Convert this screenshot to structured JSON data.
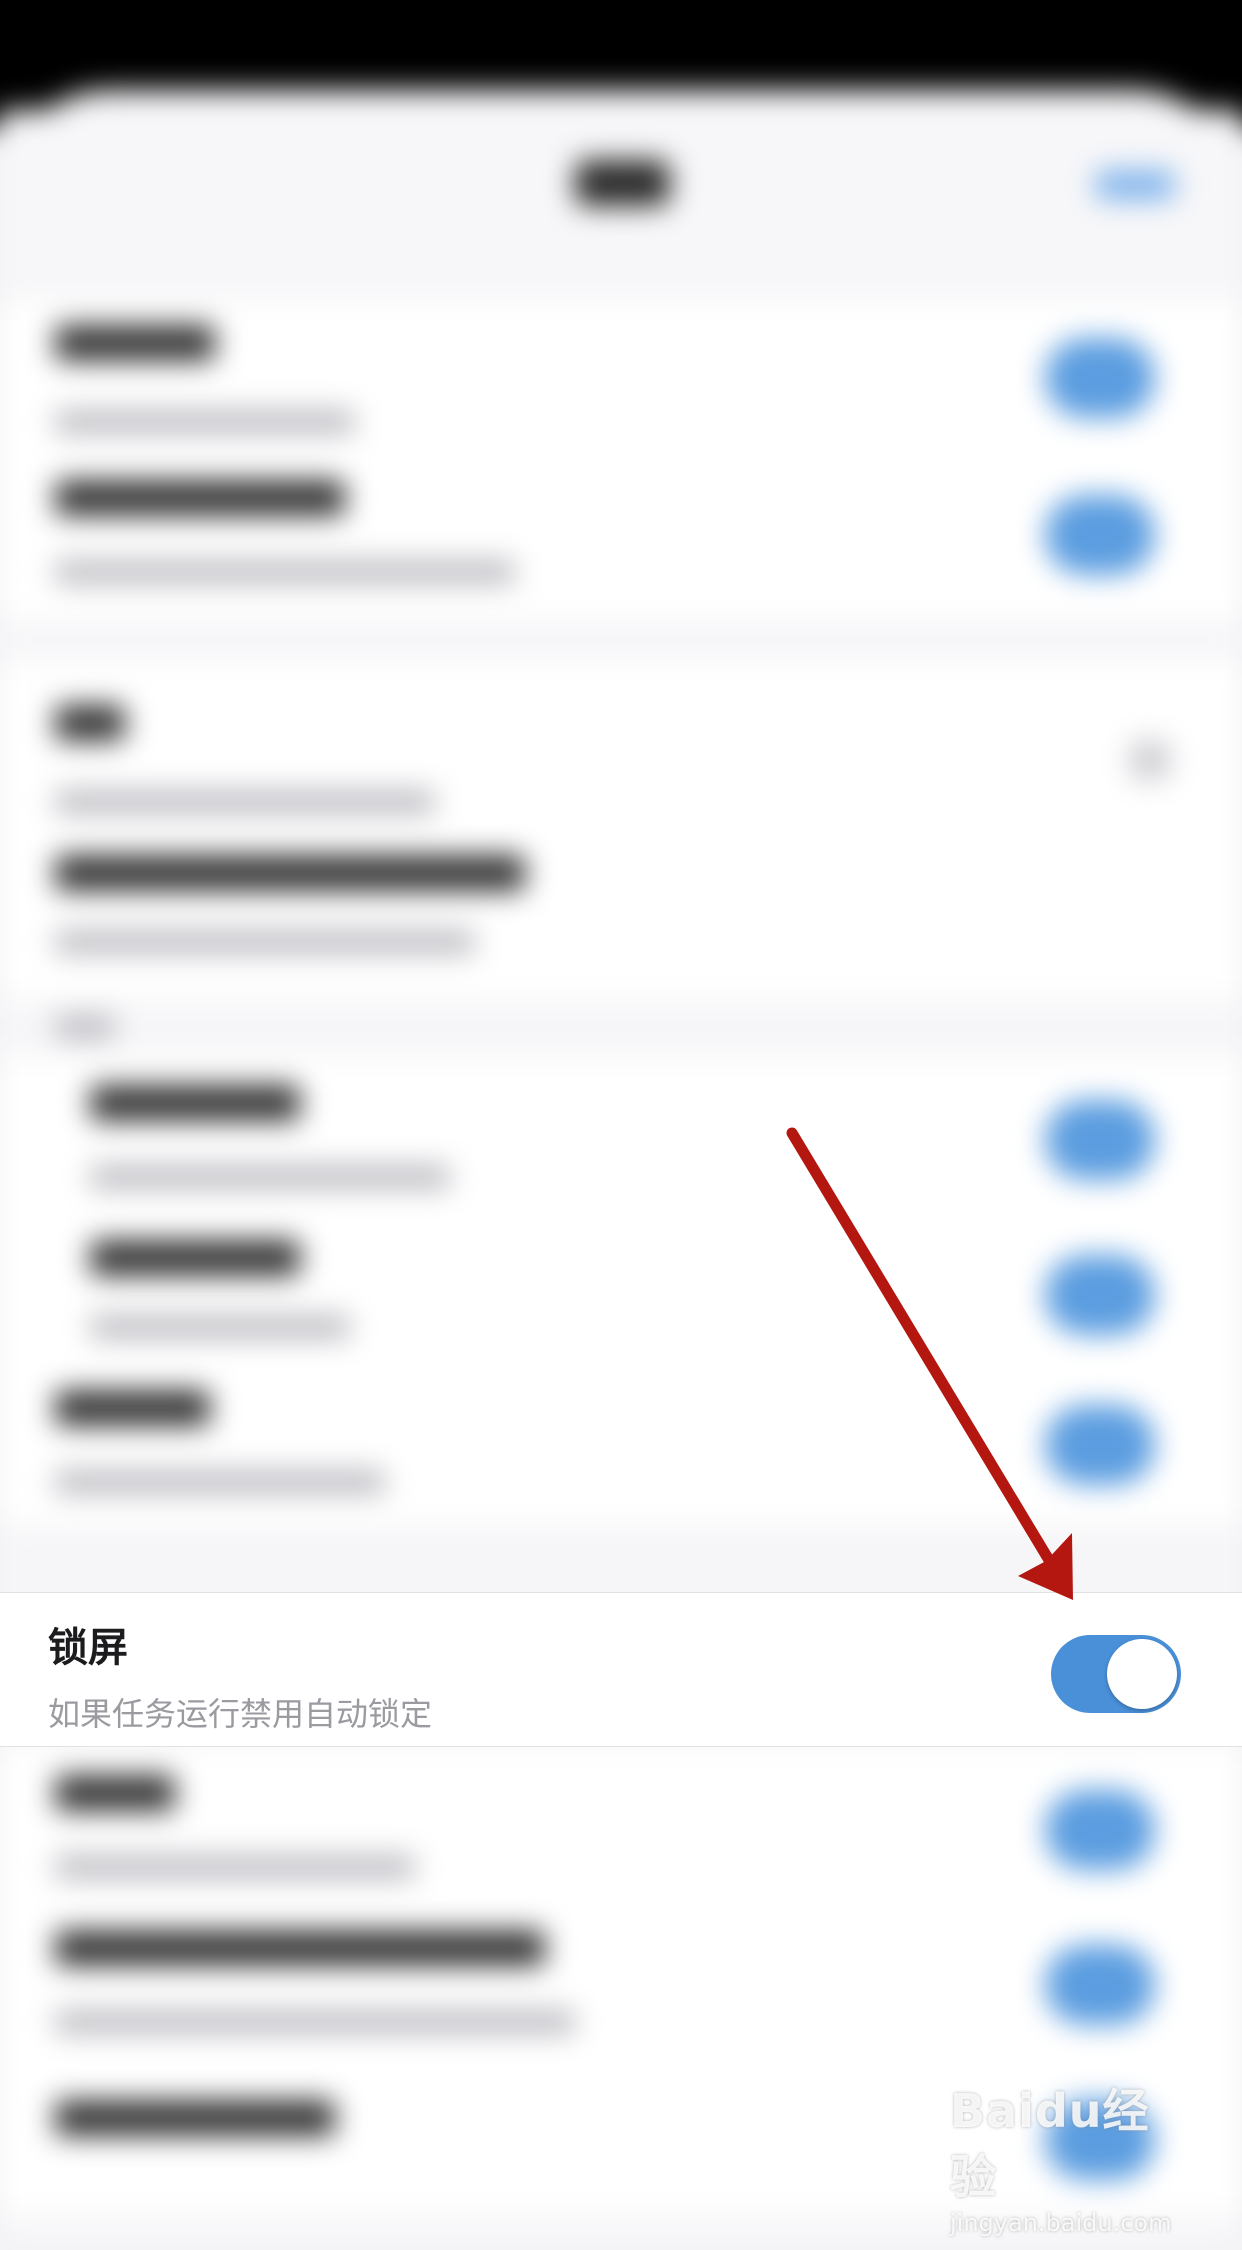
{
  "focused_row": {
    "title": "锁屏",
    "subtitle": "如果任务运行禁用自动锁定",
    "toggle_state": "on"
  },
  "colors": {
    "toggle_on": "#4a90d9",
    "arrow": "#b3170f",
    "page_background": "#f2f2f5",
    "row_background": "#ffffff"
  },
  "annotation": {
    "type": "arrow",
    "points_to": "lock-screen-toggle"
  },
  "watermark": {
    "main": "Baidu经验",
    "sub": "jingyan.baidu.com"
  }
}
